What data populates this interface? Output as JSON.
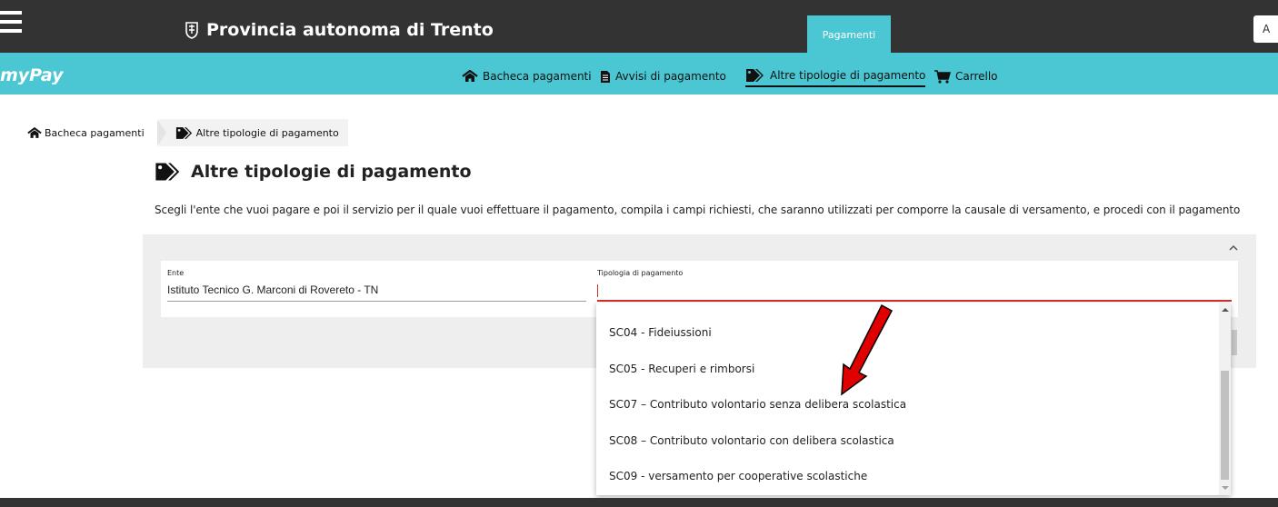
{
  "header": {
    "brand": "Provincia autonoma di Trento",
    "tab": "Pagamenti",
    "user_initial": "A"
  },
  "nav": {
    "logo": "myPay",
    "items": [
      {
        "label": "Bacheca pagamenti",
        "icon": "home-icon"
      },
      {
        "label": "Avvisi di pagamento",
        "icon": "document-icon"
      },
      {
        "label": "Altre tipologie di pagamento",
        "icon": "tags-icon",
        "active": true
      },
      {
        "label": "Carrello",
        "icon": "cart-icon"
      }
    ]
  },
  "breadcrumb": {
    "items": [
      {
        "label": "Bacheca pagamenti",
        "icon": "home-icon"
      },
      {
        "label": "Altre tipologie di pagamento",
        "icon": "tags-icon"
      }
    ]
  },
  "page": {
    "title": "Altre tipologie di pagamento",
    "description": "Scegli l'ente che vuoi pagare e poi il servizio per il quale vuoi effettuare il pagamento, compila i campi richiesti, che saranno utilizzati per comporre la causale di versamento, e procedi con il pagamento"
  },
  "form": {
    "ente_label": "Ente",
    "ente_value": "Istituto Tecnico G. Marconi di Rovereto - TN",
    "tipologia_label": "Tipologia di pagamento",
    "tipologia_value": ""
  },
  "dropdown": {
    "options": [
      "SC04 - Fideiussioni",
      "SC05 - Recuperi e rimborsi",
      "SC07 – Contributo volontario senza delibera scolastica",
      "SC08 – Contributo volontario con delibera scolastica",
      "SC09 - versamento per cooperative scolastiche"
    ]
  },
  "colors": {
    "topbar": "#333333",
    "accent": "#4bc6d3",
    "error": "#d32f2f",
    "annotation_arrow": "#e00000"
  }
}
